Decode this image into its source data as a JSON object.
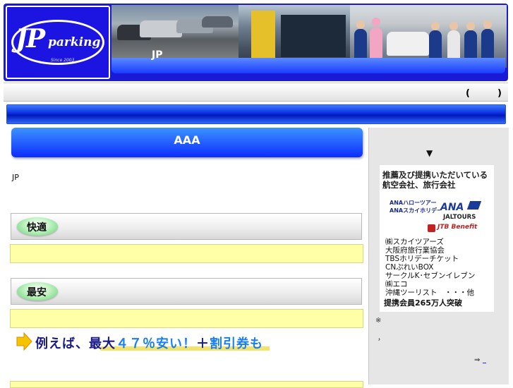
{
  "header": {
    "logo_main": "JP",
    "logo_sub": "parking",
    "logo_since": "Since 2003",
    "banner_text": "JP"
  },
  "gray_bar": {
    "paren_text": "(　　　)"
  },
  "main": {
    "title": "AAA",
    "intro": "JP",
    "sections": [
      {
        "label": "快適"
      },
      {
        "label": "最安"
      }
    ],
    "promo": {
      "part1": "例えば、最大",
      "part2": "４７％安い！",
      "part3": "＋",
      "part4": "割引券も"
    }
  },
  "sidebar": {
    "arrow": "▼",
    "partner_title": "推薦及び提携いただいている航空会社、旅行会社",
    "logos": {
      "ana_hallo_1": "ANAハローツアー",
      "ana_hallo_2": "ANAスカイホリデー",
      "ana": "ANA",
      "jaltours": "JALTOURS",
      "jtb": "JTB Benefit"
    },
    "partners": [
      "㈱スカイツアーズ",
      "大阪府旅行業協会",
      "TBSホリデーチケット",
      "CNぷれいBOX",
      "サークルK･セブンイレブン",
      "㈱エコ",
      "沖縄ツーリスト　・・・他"
    ],
    "members": "提携会員265万人突破",
    "note1": "※",
    "note2": "，",
    "link_arrow": "⇒",
    "link_text": "_"
  },
  "colors": {
    "header_blue": "#1a1ad6",
    "nav_blue": "#0a2ce0",
    "highlight_yellow": "#ffffa8",
    "promo_blue": "#1a7ff0",
    "promo_navy": "#1a1a88"
  }
}
